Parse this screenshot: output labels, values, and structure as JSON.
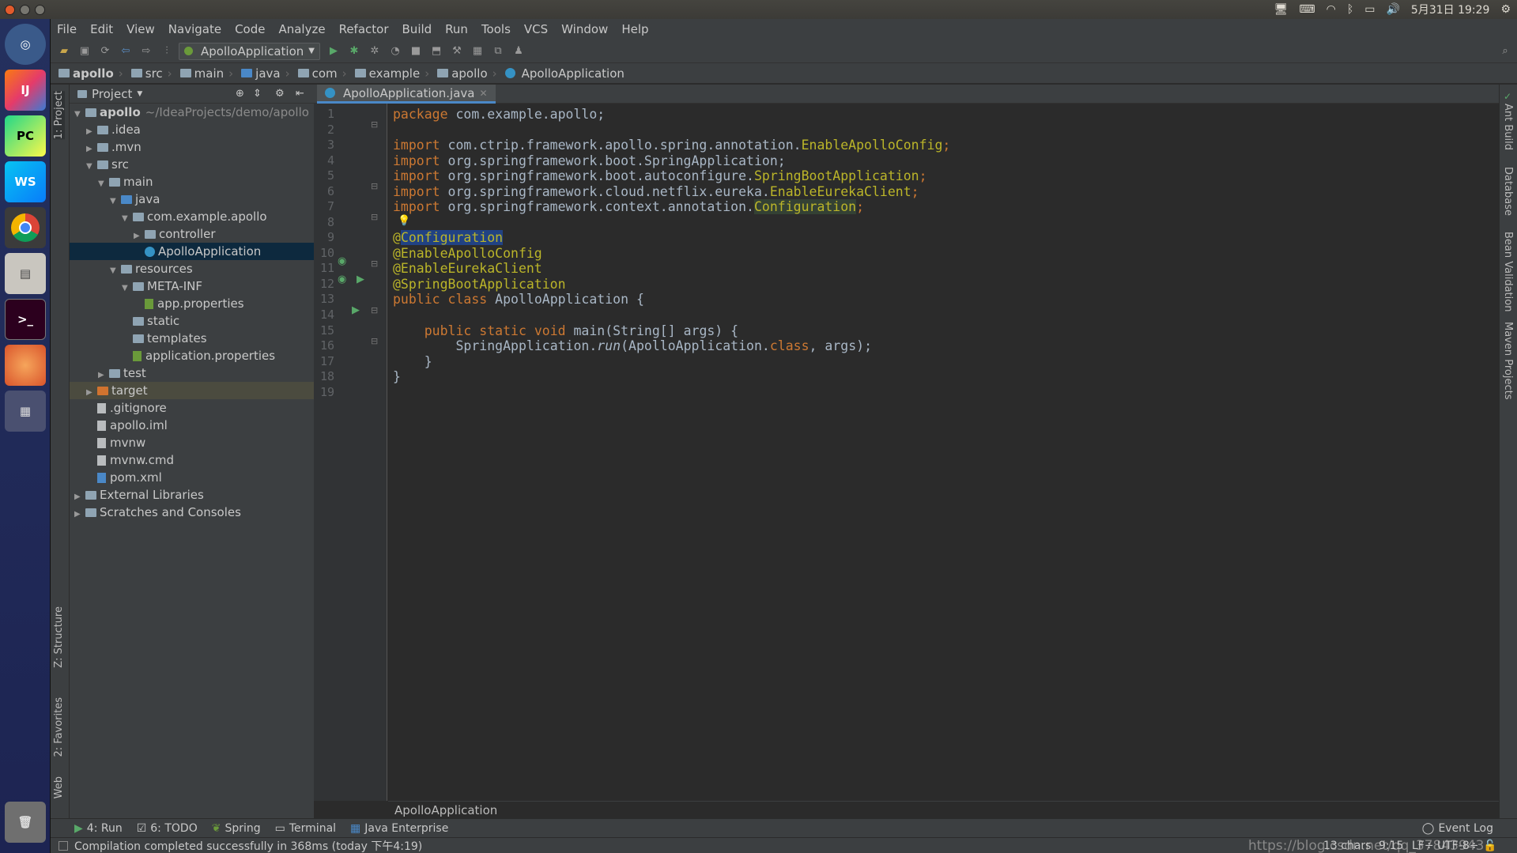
{
  "system": {
    "clock": "5月31日 19:29"
  },
  "menu": [
    "File",
    "Edit",
    "View",
    "Navigate",
    "Code",
    "Analyze",
    "Refactor",
    "Build",
    "Run",
    "Tools",
    "VCS",
    "Window",
    "Help"
  ],
  "toolbar": {
    "run_config": "ApolloApplication"
  },
  "breadcrumb": [
    "apollo",
    "src",
    "main",
    "java",
    "com",
    "example",
    "apollo",
    "ApolloApplication"
  ],
  "project_panel": {
    "title": "Project",
    "tree": [
      {
        "label": "apollo",
        "suffix": "~/IdeaProjects/demo/apollo",
        "depth": 0,
        "open": true,
        "kind": "module"
      },
      {
        "label": ".idea",
        "depth": 1,
        "open": false,
        "kind": "folder"
      },
      {
        "label": ".mvn",
        "depth": 1,
        "open": false,
        "kind": "folder"
      },
      {
        "label": "src",
        "depth": 1,
        "open": true,
        "kind": "folder"
      },
      {
        "label": "main",
        "depth": 2,
        "open": true,
        "kind": "folder"
      },
      {
        "label": "java",
        "depth": 3,
        "open": true,
        "kind": "source"
      },
      {
        "label": "com.example.apollo",
        "depth": 4,
        "open": true,
        "kind": "package"
      },
      {
        "label": "controller",
        "depth": 5,
        "open": false,
        "kind": "package"
      },
      {
        "label": "ApolloApplication",
        "depth": 5,
        "kind": "class",
        "selected": true
      },
      {
        "label": "resources",
        "depth": 3,
        "open": true,
        "kind": "resource"
      },
      {
        "label": "META-INF",
        "depth": 4,
        "open": true,
        "kind": "folder"
      },
      {
        "label": "app.properties",
        "depth": 5,
        "kind": "props"
      },
      {
        "label": "static",
        "depth": 4,
        "kind": "folder"
      },
      {
        "label": "templates",
        "depth": 4,
        "kind": "folder"
      },
      {
        "label": "application.properties",
        "depth": 4,
        "kind": "props"
      },
      {
        "label": "test",
        "depth": 2,
        "open": false,
        "kind": "folder"
      },
      {
        "label": "target",
        "depth": 1,
        "open": false,
        "kind": "excluded"
      },
      {
        "label": ".gitignore",
        "depth": 1,
        "kind": "file"
      },
      {
        "label": "apollo.iml",
        "depth": 1,
        "kind": "file"
      },
      {
        "label": "mvnw",
        "depth": 1,
        "kind": "file"
      },
      {
        "label": "mvnw.cmd",
        "depth": 1,
        "kind": "file"
      },
      {
        "label": "pom.xml",
        "depth": 1,
        "kind": "maven"
      },
      {
        "label": "External Libraries",
        "depth": 0,
        "open": false,
        "kind": "lib"
      },
      {
        "label": "Scratches and Consoles",
        "depth": 0,
        "open": false,
        "kind": "scratch"
      }
    ]
  },
  "left_tools": {
    "project": "1: Project",
    "structure": "Z: Structure",
    "favorites": "2: Favorites",
    "web": "Web"
  },
  "right_tools": {
    "ant": "Ant Build",
    "database": "Database",
    "bean": "Bean Validation",
    "maven": "Maven Projects"
  },
  "editor": {
    "tab": "ApolloApplication.java",
    "footer_breadcrumb": "ApolloApplication",
    "lines": [
      "1",
      "2",
      "3",
      "4",
      "5",
      "6",
      "7",
      "8",
      "9",
      "10",
      "11",
      "12",
      "13",
      "14",
      "15",
      "16",
      "17",
      "18",
      "19"
    ],
    "code": {
      "l1a": "package",
      "l1b": " com.example.apollo;",
      "l3a": "import",
      "l3b": " com.ctrip.framework.apollo.spring.annotation.",
      "l3c": "EnableApolloConfig",
      "l4a": "import",
      "l4b": " org.springframework.boot.SpringApplication;",
      "l5a": "import",
      "l5b": " org.springframework.boot.autoconfigure.",
      "l5c": "SpringBootApplication",
      "l6a": "import",
      "l6b": " org.springframework.cloud.netflix.eureka.",
      "l6c": "EnableEurekaClient",
      "l7a": "import",
      "l7b": " org.springframework.context.annotation.",
      "l7c": "Configuration",
      "l9a": "@",
      "l9b": "Configuration",
      "l10": "@EnableApolloConfig",
      "l11": "@EnableEurekaClient",
      "l12": "@SpringBootApplication",
      "l13a": "public class",
      "l13b": " ApolloApplication {",
      "l15a": "public static void",
      "l15b": " main(String[] args) {",
      "l16a": "SpringApplication.",
      "l16b": "run",
      "l16c": "(ApolloApplication.",
      "l16d": "class",
      ", args);": "",
      "l16e": ", args);",
      "l17": "}",
      "l18": "}"
    }
  },
  "bottom_tabs": [
    "4: Run",
    "6: TODO",
    "Spring",
    "Terminal",
    "Java Enterprise",
    "Event Log"
  ],
  "status": {
    "message": "Compilation completed successfully in 368ms (today 下午4:19)",
    "chars": "13 chars",
    "position": "9:15",
    "line_sep": "LF÷",
    "encoding": "UTF-8÷",
    "watermark": "https://blog.csdn.net/qq_37843943"
  }
}
